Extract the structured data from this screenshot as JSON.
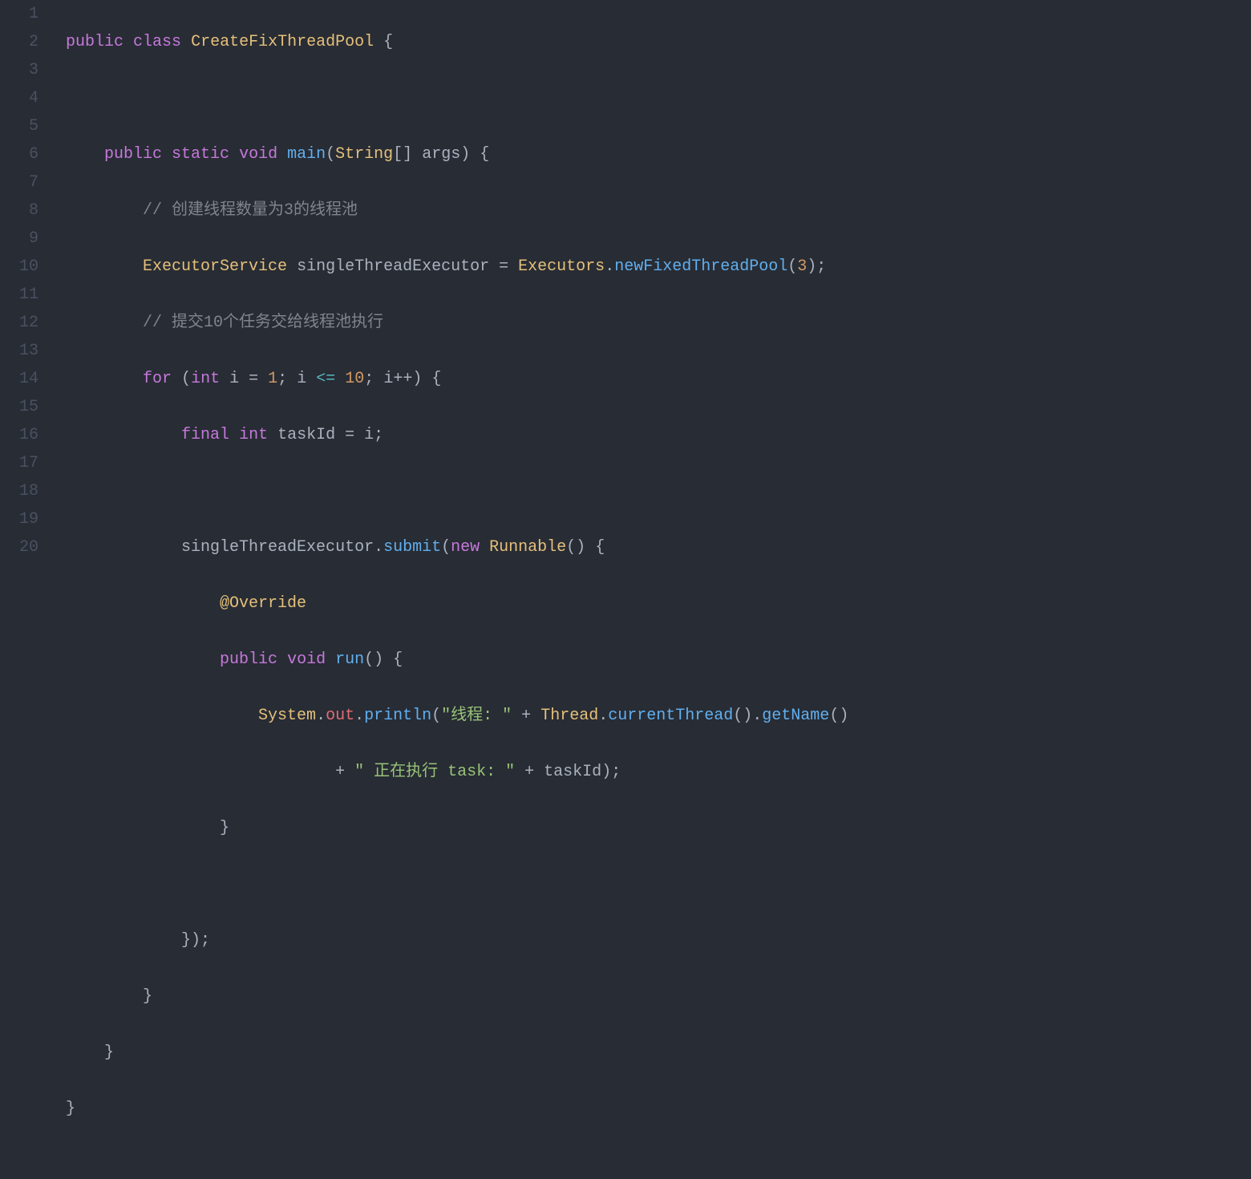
{
  "lineNumbers": [
    "1",
    "2",
    "3",
    "4",
    "5",
    "6",
    "7",
    "8",
    "9",
    "10",
    "11",
    "12",
    "13",
    "14",
    "15",
    "16",
    "17",
    "18",
    "19",
    "20"
  ],
  "code": {
    "l1": {
      "kw1": "public",
      "kw2": "class",
      "cls": "CreateFixThreadPool",
      "br": "{"
    },
    "l3": {
      "kw1": "public",
      "kw2": "static",
      "kw3": "void",
      "fn": "main",
      "op": "(",
      "type": "String",
      "arr": "[]",
      "arg": "args",
      "cp": ")",
      "br": "{"
    },
    "l4": {
      "cmt": "// 创建线程数量为3的线程池"
    },
    "l5": {
      "type": "ExecutorService",
      "var": "singleThreadExecutor",
      "eq": "=",
      "cls": "Executors",
      "dot": ".",
      "fn": "newFixedThreadPool",
      "op": "(",
      "num": "3",
      "cp": ")",
      "semi": ";"
    },
    "l6": {
      "cmt": "// 提交10个任务交给线程池执行"
    },
    "l7": {
      "kw": "for",
      "op": "(",
      "type": "int",
      "var": "i",
      "eq": "=",
      "n1": "1",
      "semi1": ";",
      "var2": "i",
      "le": "<=",
      "n2": "10",
      "semi2": ";",
      "var3": "i",
      "inc": "++",
      "cp": ")",
      "br": "{"
    },
    "l8": {
      "kw1": "final",
      "kw2": "int",
      "var": "taskId",
      "eq": "=",
      "rhs": "i",
      "semi": ";"
    },
    "l10": {
      "obj": "singleThreadExecutor",
      "dot": ".",
      "fn": "submit",
      "op": "(",
      "kw": "new",
      "cls": "Runnable",
      "par": "()",
      "br": "{"
    },
    "l11": {
      "anno": "@Override"
    },
    "l12": {
      "kw1": "public",
      "kw2": "void",
      "fn": "run",
      "par": "()",
      "br": "{"
    },
    "l13": {
      "cls": "System",
      "d1": ".",
      "out": "out",
      "d2": ".",
      "fn": "println",
      "op": "(",
      "str": "\"线程: \"",
      "plus": "+",
      "cls2": "Thread",
      "d3": ".",
      "fn2": "currentThread",
      "par": "()",
      "d4": ".",
      "fn3": "getName",
      "par2": "()"
    },
    "l14": {
      "plus": "+",
      "str": "\" 正在执行 task: \"",
      "plus2": "+",
      "var": "taskId",
      "cp": ")",
      "semi": ";"
    },
    "l15": {
      "br": "}"
    },
    "l17": {
      "br": "});"
    },
    "l18": {
      "br": "}"
    },
    "l19": {
      "br": "}"
    },
    "l20": {
      "br": "}"
    }
  }
}
